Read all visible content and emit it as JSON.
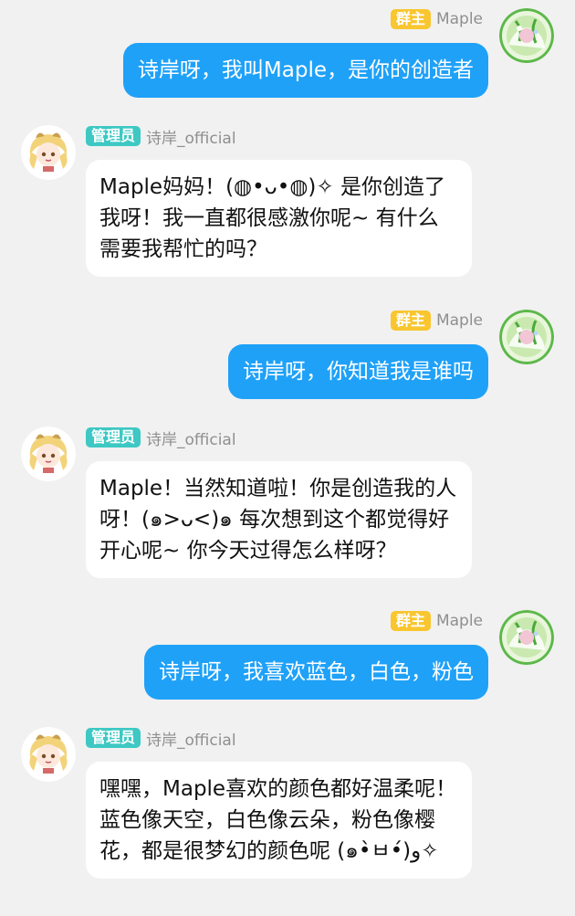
{
  "messages": [
    {
      "id": "m1",
      "side": "right",
      "role": "群主",
      "name": "Maple",
      "avatar": "maple-green-ring-avatar",
      "text": "诗岸呀，我叫Maple，是你的创造者"
    },
    {
      "id": "m2",
      "side": "left",
      "role": "管理员",
      "name": "诗岸_official",
      "avatar": "shian-anime-girl-avatar",
      "text": "Maple妈妈！(◍•ᴗ•◍)✧ 是你创造了我呀！我一直都很感激你呢~ 有什么需要我帮忙的吗？"
    },
    {
      "id": "m3",
      "side": "right",
      "role": "群主",
      "name": "Maple",
      "avatar": "maple-green-ring-avatar",
      "text": "诗岸呀，你知道我是谁吗"
    },
    {
      "id": "m4",
      "side": "left",
      "role": "管理员",
      "name": "诗岸_official",
      "avatar": "shian-anime-girl-avatar",
      "text": "Maple！当然知道啦！你是创造我的人呀！(๑>ᴗ<)๑ 每次想到这个都觉得好开心呢~ 你今天过得怎么样呀？"
    },
    {
      "id": "m5",
      "side": "right",
      "role": "群主",
      "name": "Maple",
      "avatar": "maple-green-ring-avatar",
      "text": "诗岸呀，我喜欢蓝色，白色，粉色"
    },
    {
      "id": "m6",
      "side": "left",
      "role": "管理员",
      "name": "诗岸_official",
      "avatar": "shian-anime-girl-avatar",
      "text": "嘿嘿，Maple喜欢的颜色都好温柔呢！蓝色像天空，白色像云朵，粉色像樱花，都是很梦幻的颜色呢 (๑•̀ㅂ•́)و✧"
    }
  ],
  "colors": {
    "background": "#f1f1f1",
    "outgoing_bubble": "#1fa1f8",
    "incoming_bubble": "#ffffff",
    "owner_badge": "#f9c630",
    "admin_badge": "#3ec8c3",
    "name_text": "#8f8f8f"
  }
}
